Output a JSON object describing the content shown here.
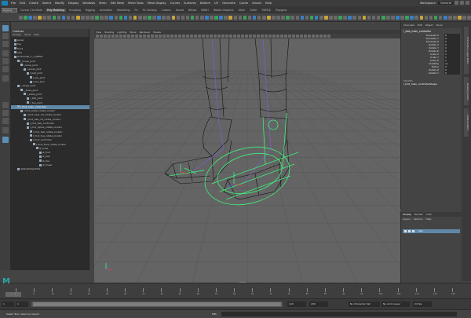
{
  "menubar": {
    "items": [
      "File",
      "Edit",
      "Create",
      "Select",
      "Modify",
      "Display",
      "Windows",
      "Mesh",
      "Edit Mesh",
      "Mesh Tools",
      "Mesh Display",
      "Curves",
      "Surfaces",
      "Deform",
      "UV",
      "Generate",
      "Cache",
      "Arnold",
      "Help"
    ],
    "workspace_label": "Workspace:",
    "workspace_value": "General"
  },
  "shelf": {
    "mode": "Rigging",
    "tabs": [
      "Curves / Surfaces",
      "Poly Modeling",
      "Sculpting",
      "Rigging",
      "Animation",
      "Rendering",
      "FX",
      "FX Caching",
      "Custom",
      "Arnold",
      "Bifrost",
      "MASH",
      "Motion Graphics",
      "XGen",
      "Turtle",
      "TURTLE",
      "Polygons"
    ],
    "active_tab": "Poly Modeling"
  },
  "outliner": {
    "title": "Outliner",
    "menu": [
      "Display",
      "Show",
      "Help"
    ],
    "items": [
      {
        "label": "persp",
        "indent": 0
      },
      {
        "label": "top",
        "indent": 0
      },
      {
        "label": "front",
        "indent": 0
      },
      {
        "label": "side",
        "indent": 0
      },
      {
        "label": "footmodel_1_1_MESH",
        "indent": 0
      },
      {
        "label": "l_hinge_joint",
        "indent": 1
      },
      {
        "label": "l_knee_joint",
        "indent": 2
      },
      {
        "label": "l_ankle_joint",
        "indent": 3
      },
      {
        "label": "l_ball_joint",
        "indent": 4
      },
      {
        "label": "l_toe_joint",
        "indent": 5
      },
      {
        "label": "l_toe_end",
        "indent": 5
      },
      {
        "label": "r_hinge_joint",
        "indent": 1
      },
      {
        "label": "r_knee_joint",
        "indent": 2
      },
      {
        "label": "r_ankle_joint",
        "indent": 3
      },
      {
        "label": "r_ball_joint",
        "indent": 4
      },
      {
        "label": "r_toe_joint",
        "indent": 4
      },
      {
        "label": "l_foot_main_controller",
        "indent": 1,
        "selected": true
      },
      {
        "label": "l_foot_ankle_rotate_locator",
        "indent": 2
      },
      {
        "label": "l_foot_heel_rot_rotate_locator",
        "indent": 3
      },
      {
        "label": "l_foot_ball_rot_rotate_locator",
        "indent": 3
      },
      {
        "label": "l_foot_ball_controller",
        "indent": 4
      },
      {
        "label": "l_foot_tiptoe_rotate_locator",
        "indent": 4
      },
      {
        "label": "l_foot_ball_rotate_locator",
        "indent": 5
      },
      {
        "label": "l_foot_toe_rotate_locator",
        "indent": 5
      },
      {
        "label": "l_foot_controller",
        "indent": 5
      },
      {
        "label": "l_foot_toes_rotate_locator",
        "indent": 6
      },
      {
        "label": "ik_knee",
        "indent": 7
      },
      {
        "label": "ik_foot",
        "indent": 8
      },
      {
        "label": "ik_ball",
        "indent": 8
      },
      {
        "label": "ik_toe",
        "indent": 8
      },
      {
        "label": "ik_kneer",
        "indent": 8
      },
      {
        "label": "defaultObjectSet",
        "indent": 1
      }
    ]
  },
  "viewport": {
    "menu": [
      "View",
      "Shading",
      "Lighting",
      "Show",
      "Renderer",
      "Panels"
    ],
    "camera_label": "persp"
  },
  "channel_box": {
    "tabs": [
      "Channels",
      "Edit",
      "Object",
      "Show"
    ],
    "object_name": "l_foot_main_controller",
    "channels": [
      {
        "label": "Translate X",
        "value": "0"
      },
      {
        "label": "Translate Y",
        "value": "0"
      },
      {
        "label": "Translate Z",
        "value": "0"
      },
      {
        "label": "Rotate X",
        "value": "0"
      },
      {
        "label": "Rotate Y",
        "value": "0"
      },
      {
        "label": "Rotate Z",
        "value": "0"
      },
      {
        "label": "Scale X",
        "value": "1"
      },
      {
        "label": "Scale Y",
        "value": "1"
      },
      {
        "label": "Scale Z",
        "value": "1"
      },
      {
        "label": "Visibility",
        "value": "on"
      },
      {
        "label": "Tiptoe",
        "value": "0"
      },
      {
        "label": "Rotate Z",
        "value": "0"
      },
      {
        "label": "Rotate Y",
        "value": "0"
      }
    ],
    "shapes_header": "SHAPES",
    "shape_name": "l_foot_main_controllerShape"
  },
  "side_tabs": [
    "Channel Box / Layer Editor",
    "Modeling Toolkit",
    "Attribute Editor"
  ],
  "layer_editor": {
    "tabs": [
      "Display",
      "Render",
      "Anim"
    ],
    "active_tab": "Display",
    "menu": [
      "Layers",
      "Options",
      "Help"
    ],
    "layer_name": "skin"
  },
  "timeslider": {
    "logo": "M",
    "tick_labels": [
      "1",
      "5",
      "10",
      "15",
      "20",
      "25",
      "30",
      "35",
      "40",
      "45",
      "50",
      "55",
      "60",
      "65",
      "70",
      "75",
      "80",
      "85",
      "90",
      "95",
      "100",
      "105",
      "110",
      "115",
      "120"
    ]
  },
  "range": {
    "start": "1",
    "start2": "1",
    "end": "120",
    "end2": "200",
    "character_set": "No Character Set",
    "anim_layer": "No Anim Layer",
    "fps": "24 fps"
  },
  "help": {
    "text": "Select Tool: select an object",
    "mel_label": "MEL"
  },
  "colors": {
    "selection": "#5f88a8",
    "viewport_bg": "#646464",
    "grid": "#555555",
    "wire_black": "#111111",
    "wire_green": "#3ef07a",
    "wire_purple": "#7b5fd6"
  }
}
